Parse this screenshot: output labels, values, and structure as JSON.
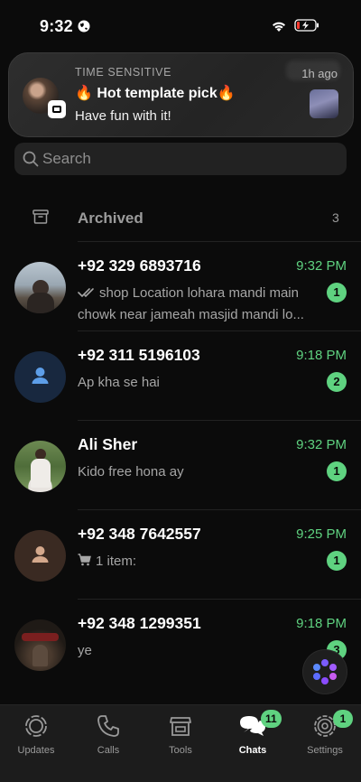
{
  "status_bar": {
    "time": "9:32"
  },
  "notification": {
    "label": "TIME SENSITIVE",
    "title": "🔥 Hot template pick🔥",
    "body": "Have fun with it!",
    "age": "1h ago"
  },
  "search": {
    "placeholder": "Search"
  },
  "archived": {
    "label": "Archived",
    "count": "3"
  },
  "chats": [
    {
      "name": "+92 329 6893716",
      "time": "9:32 PM",
      "preview": "shop Location lohara mandi main chowk near jameah masjid mandi lo...",
      "unread": "1"
    },
    {
      "name": "+92 311 5196103",
      "time": "9:18 PM",
      "preview": "Ap kha se hai",
      "unread": "2"
    },
    {
      "name": "Ali Sher",
      "time": "9:32 PM",
      "preview": "Kido free hona ay",
      "unread": "1"
    },
    {
      "name": "+92 348 7642557",
      "time": "9:25 PM",
      "preview": "1 item:",
      "unread": "1"
    },
    {
      "name": "+92 348 1299351",
      "time": "9:18 PM",
      "preview": "ye",
      "unread": "3"
    }
  ],
  "tabbar": {
    "tabs": [
      {
        "label": "Updates",
        "icon": "updates-icon"
      },
      {
        "label": "Calls",
        "icon": "phone-icon"
      },
      {
        "label": "Tools",
        "icon": "storefront-icon"
      },
      {
        "label": "Chats",
        "icon": "chats-icon",
        "badge": "11"
      },
      {
        "label": "Settings",
        "icon": "gear-icon",
        "badge": "1"
      }
    ]
  },
  "colors": {
    "accent": "#5fd280",
    "background": "#0b0b0b"
  }
}
